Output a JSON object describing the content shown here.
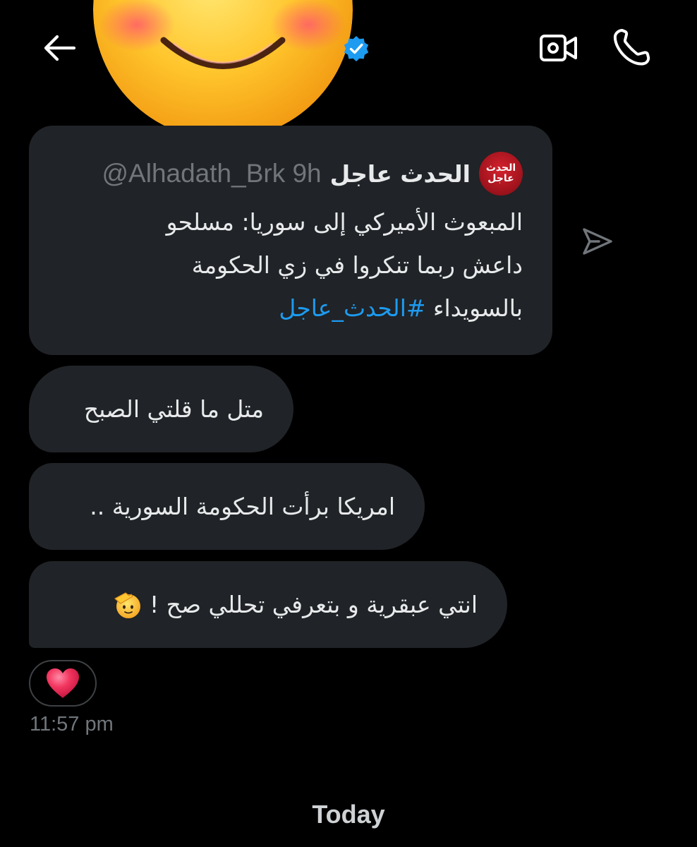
{
  "header": {
    "back_icon": "arrow-left-icon",
    "avatar_icon": "smiling-face-avatar",
    "verified_icon": "verified-badge-icon",
    "video_icon": "video-camera-icon",
    "call_icon": "phone-icon",
    "accent_color": "#1d9bf0"
  },
  "shared_tweet": {
    "avatar_line1": "الحدث",
    "avatar_line2": "عاجل",
    "author_name": "الحدث عاجل",
    "meta": "@Alhadath_Brk 9h",
    "text_line1": "المبعوث الأميركي إلى سوريا: مسلحو",
    "text_line2": "داعش ربما تنكروا في زي الحكومة",
    "text_line3": "بالسويداء ",
    "hashtag": "#الحدث_عاجل"
  },
  "share_icon": "send-icon",
  "messages": [
    {
      "text": "متل ما قلتي الصبح"
    },
    {
      "text": "امريكا برأت الحكومة السورية .."
    },
    {
      "text": "انتي عبقرية و بتعرفي تحللي صح !",
      "emoji": "saluting-face-icon"
    }
  ],
  "reaction": {
    "emoji": "red-heart-icon",
    "color": "#e3264f"
  },
  "timestamp": "11:57 pm",
  "date_divider": "Today"
}
